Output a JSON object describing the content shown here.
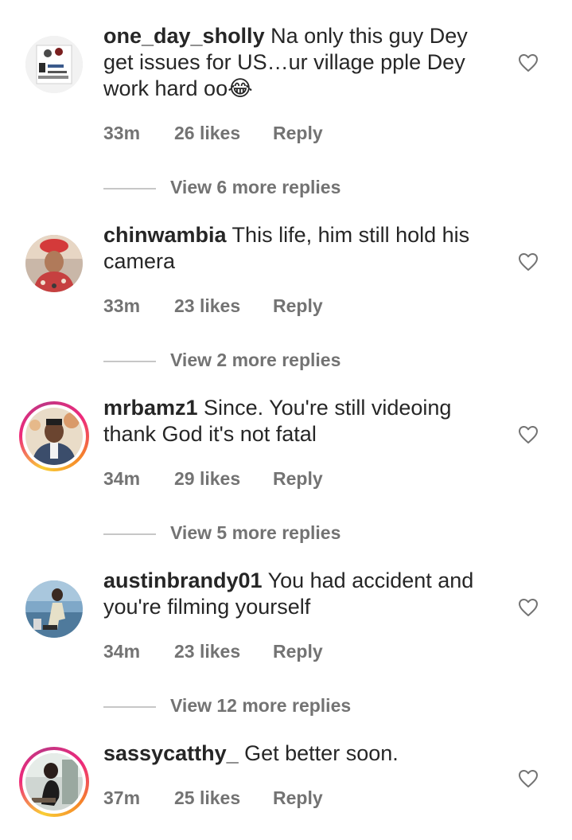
{
  "comments": [
    {
      "username": "one_day_sholly",
      "text": " Na only this guy Dey get issues for US…ur village pple Dey work hard oo😂",
      "time": "33m",
      "likes": "26 likes",
      "reply": "Reply",
      "view_replies": "View 6 more replies"
    },
    {
      "username": "chinwambia",
      "text": " This life, him still hold his camera",
      "time": "33m",
      "likes": "23 likes",
      "reply": "Reply",
      "view_replies": "View 2 more replies"
    },
    {
      "username": "mrbamz1",
      "text": " Since. You're still videoing thank God it's not fatal",
      "time": "34m",
      "likes": "29 likes",
      "reply": "Reply",
      "view_replies": "View 5 more replies"
    },
    {
      "username": "austinbrandy01",
      "text": " You had accident and you're filming yourself",
      "time": "34m",
      "likes": "23 likes",
      "reply": "Reply",
      "view_replies": "View 12 more replies"
    },
    {
      "username": "sassycatthy_",
      "text": " Get better soon.",
      "time": "37m",
      "likes": "25 likes",
      "reply": "Reply"
    }
  ],
  "icons": {
    "like": "heart-outline-icon"
  },
  "colors": {
    "text": "#262626",
    "secondary": "#737373",
    "divider": "#c7c7c7",
    "story_ring_start": "#f9ce34",
    "story_ring_end": "#ee2a7b"
  }
}
